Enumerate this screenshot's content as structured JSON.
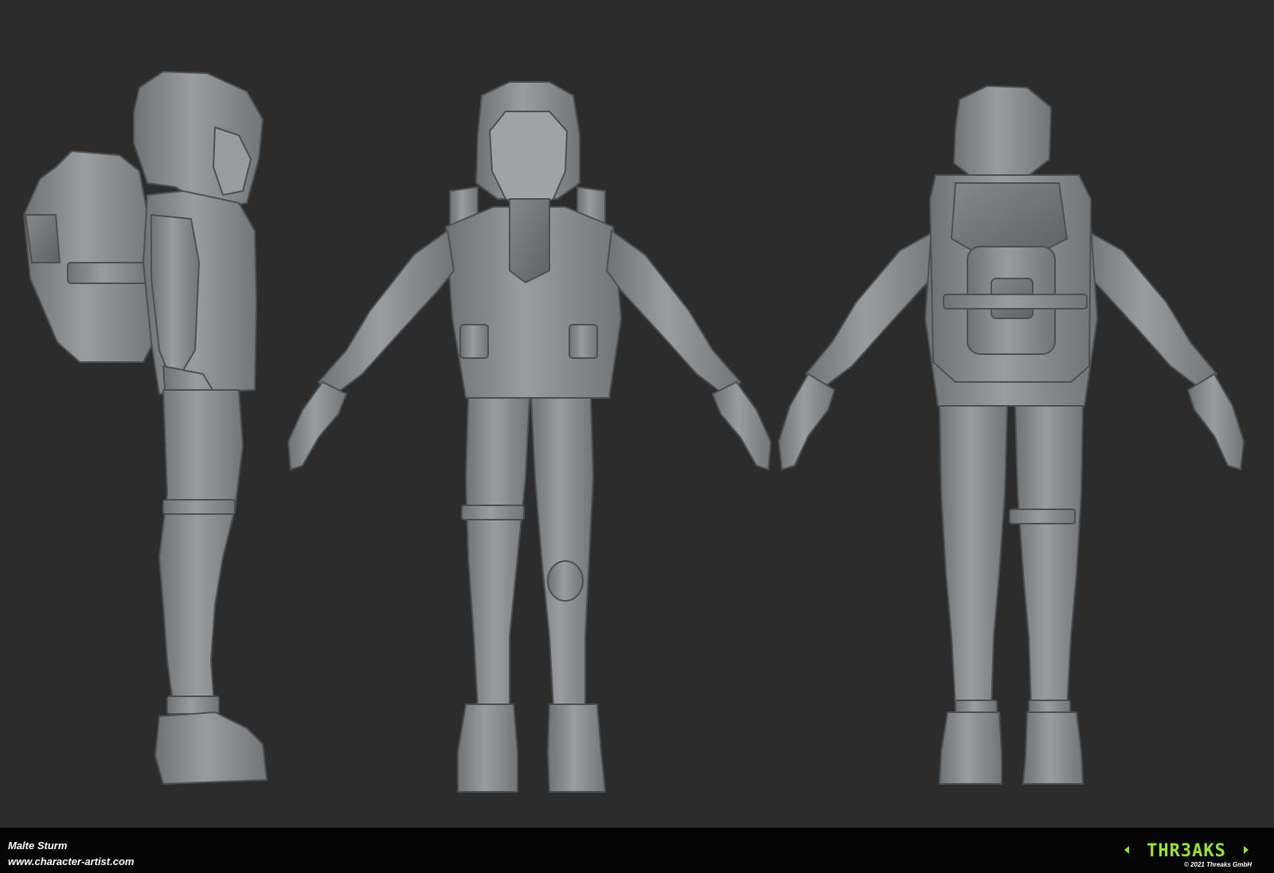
{
  "credits": {
    "artist": "Malte Sturm",
    "website": "www.character-artist.com"
  },
  "brand": {
    "logo_text": "THR3AKS",
    "copyright": "© 2021 Threaks GmbH",
    "logo_color": "#9be22d"
  },
  "scene": {
    "background_color": "#2c2c2c",
    "model_color": "#8c8f92",
    "views": [
      "side",
      "front",
      "back"
    ]
  }
}
